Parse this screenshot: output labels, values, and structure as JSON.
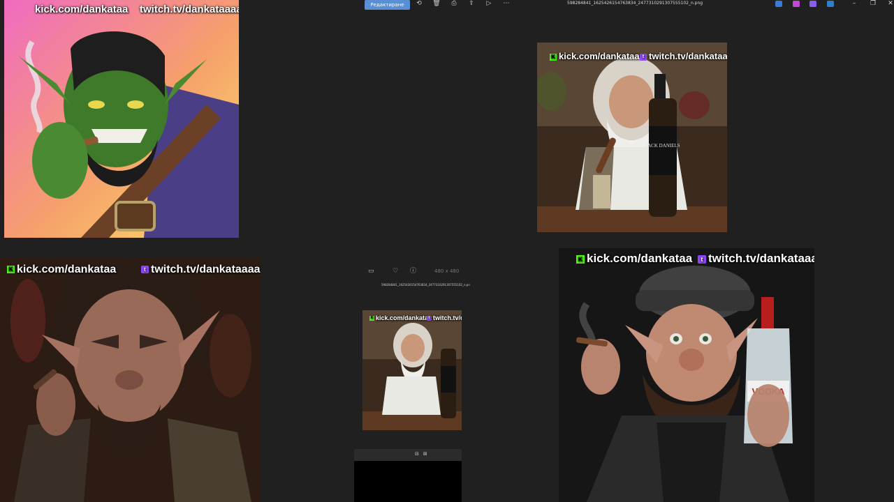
{
  "toolbar": {
    "edit_label": "Редактиране",
    "filename": "598284841_1625426154763834_2477310291307555102_n.png",
    "icons": [
      "rotate-icon",
      "delete-icon",
      "print-icon",
      "share-icon",
      "slideshow-icon",
      "more-icon"
    ]
  },
  "window": {
    "minimize": "–",
    "restore": "❐",
    "close": "✕"
  },
  "overlay": {
    "kick": "kick.com/dankataa",
    "twitch": "twitch.tv/dankataaaa",
    "kick_short": "kick.com/dankataa",
    "twitch_short": "twitch.tv/da"
  },
  "thumbnail": {
    "dims": "480 x 480",
    "name": "598284841_1625426154763834_2477310291307555102_n.pn"
  },
  "colors": {
    "kick": "#53fc18",
    "twitch": "#9146ff",
    "accent": "#5a8fd6",
    "background": "#202020"
  }
}
